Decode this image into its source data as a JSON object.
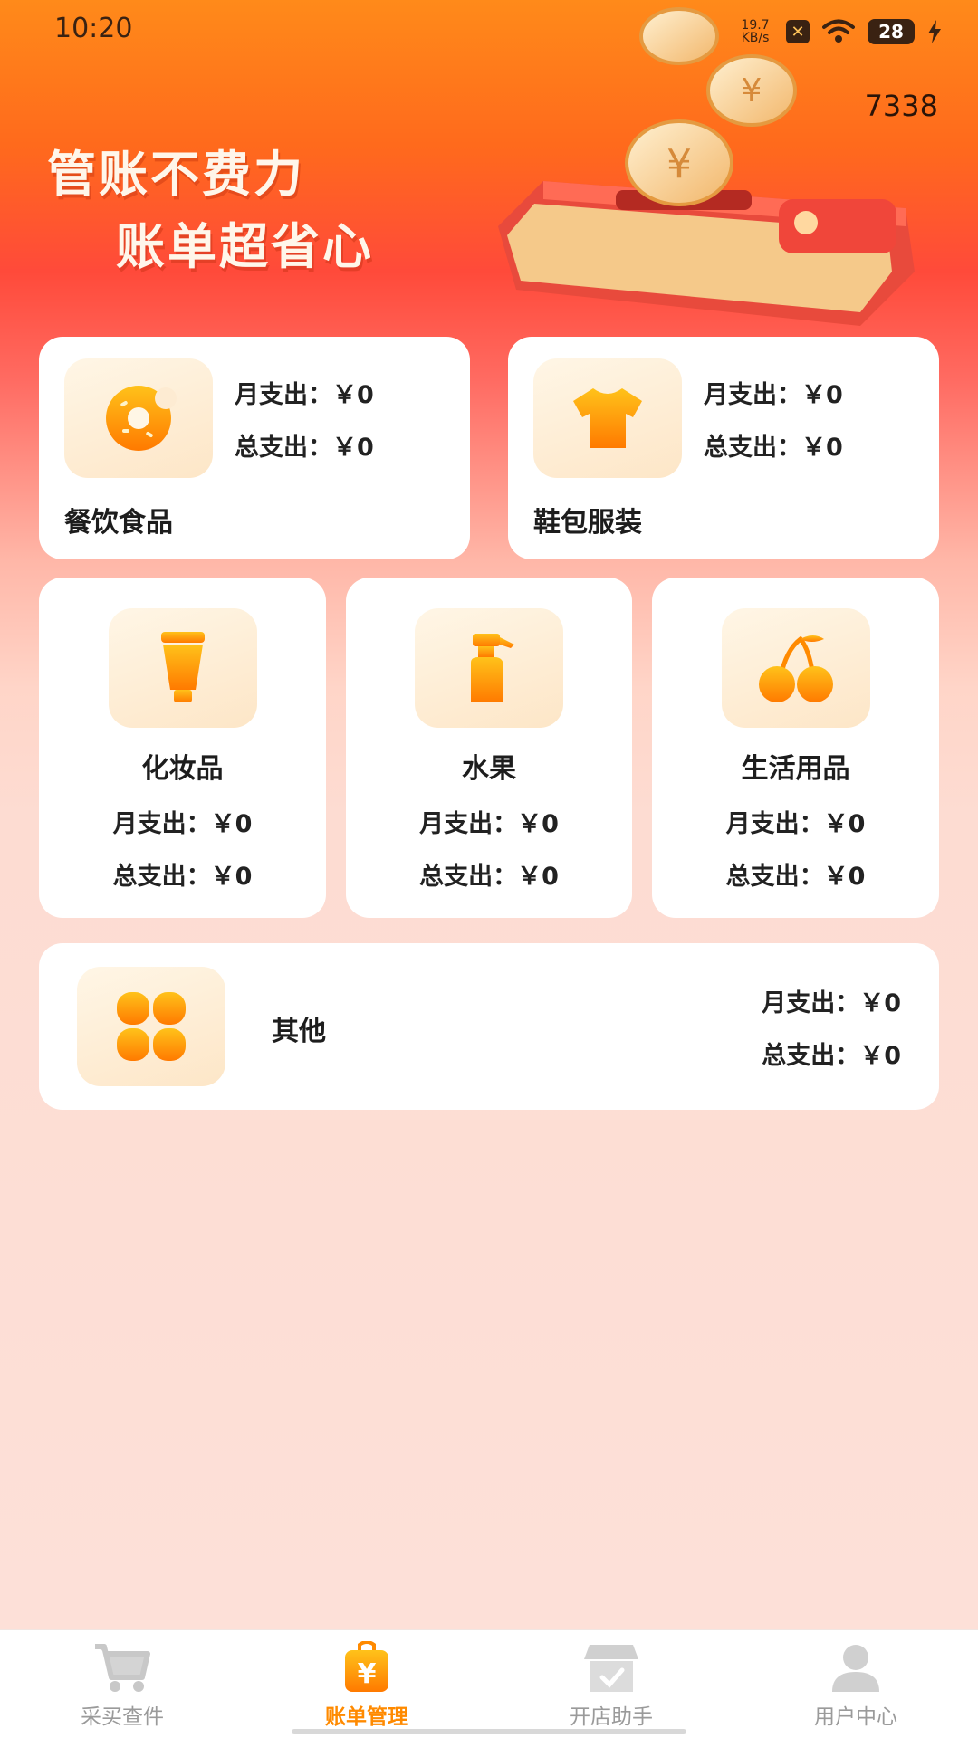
{
  "status_bar": {
    "time": "10:20",
    "net_speed_value": "19.7",
    "net_speed_unit": "KB/s",
    "sim_badge": "✕",
    "battery_level": "28",
    "icons": [
      "sim-icon",
      "wifi-icon",
      "battery-icon",
      "charging-icon"
    ]
  },
  "hero": {
    "score": "7338",
    "headline_line1": "管账不费力",
    "headline_line2": "账单超省心"
  },
  "categories": {
    "food": {
      "name": "餐饮食品",
      "monthly": "月支出：￥0",
      "total": "总支出：￥0",
      "icon": "donut-icon"
    },
    "clothing": {
      "name": "鞋包服装",
      "monthly": "月支出：￥0",
      "total": "总支出：￥0",
      "icon": "tshirt-icon"
    },
    "cosmetics": {
      "name": "化妆品",
      "monthly": "月支出：￥0",
      "total": "总支出：￥0",
      "icon": "tube-icon"
    },
    "fruit": {
      "name": "水果",
      "monthly": "月支出：￥0",
      "total": "总支出：￥0",
      "icon": "spray-bottle-icon"
    },
    "daily": {
      "name": "生活用品",
      "monthly": "月支出：￥0",
      "total": "总支出：￥0",
      "icon": "cherry-icon"
    },
    "other": {
      "name": "其他",
      "monthly": "月支出：￥0",
      "total": "总支出：￥0",
      "icon": "grid-icon"
    }
  },
  "bottom_nav": {
    "items": [
      {
        "label": "采买查件",
        "icon": "cart-icon",
        "active": false
      },
      {
        "label": "账单管理",
        "icon": "bill-bag-icon",
        "active": true
      },
      {
        "label": "开店助手",
        "icon": "store-icon",
        "active": false
      },
      {
        "label": "用户中心",
        "icon": "user-icon",
        "active": false
      }
    ]
  },
  "colors": {
    "accent": "#ff8a00",
    "icon_gradient_top": "#ffc21a",
    "icon_gradient_bottom": "#ff7a00",
    "inactive_nav": "#9a9a9a"
  }
}
